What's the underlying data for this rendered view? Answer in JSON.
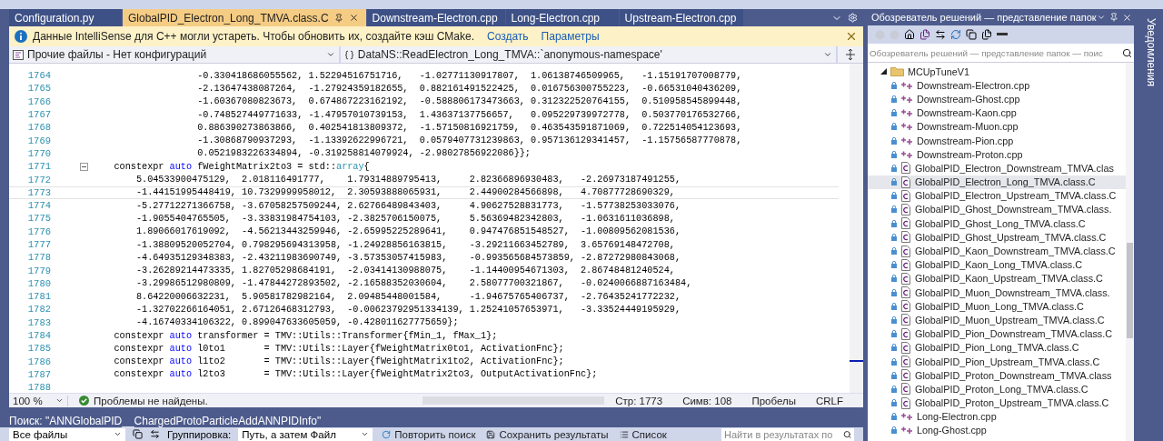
{
  "editor_tabs": [
    {
      "label": "Configuration.py",
      "selected": false
    },
    {
      "label": "GlobalPID_Electron_Long_TMVA.class.C",
      "selected": true
    },
    {
      "label": "Downstream-Electron.cpp",
      "selected": false
    },
    {
      "label": "Long-Electron.cpp",
      "selected": false
    },
    {
      "label": "Upstream-Electron.cpp",
      "selected": false
    }
  ],
  "info_bar": {
    "message": "Данные IntelliSense для C++ могли устареть. Чтобы обновить их, создайте кэш CMake.",
    "links": [
      "Создать",
      "Параметры"
    ]
  },
  "navigation": {
    "project": "Прочие файлы - Нет конфигураций",
    "scope": "DataNS::ReadElectron_Long_TMVA::`anonymous-namespace'"
  },
  "code_lines": [
    {
      "number": "1764",
      "current": false,
      "segments": [
        {
          "kind": "plain",
          "text": "                   -0.330418686055562, 1.52294516751716,   -1.02771130917807,  1.06138746509965,   -1.15191707008779,"
        }
      ]
    },
    {
      "number": "1765",
      "current": false,
      "segments": [
        {
          "kind": "plain",
          "text": "                   -2.13647438087264,  -1.27924359182655,  0.882161491522425,  0.016756300755223,  -0.66531040436209,"
        }
      ]
    },
    {
      "number": "1766",
      "current": false,
      "segments": [
        {
          "kind": "plain",
          "text": "                   -1.60367080823673,  0.674867223162192,  -0.588806173473663, 0.312322520764155,  0.510958545899448,"
        }
      ]
    },
    {
      "number": "1767",
      "current": false,
      "segments": [
        {
          "kind": "plain",
          "text": "                   -0.748527449771633, -1.47957010739153,  1.43637137756657,   0.095229739972778,  0.503770176532766,"
        }
      ]
    },
    {
      "number": "1768",
      "current": false,
      "segments": [
        {
          "kind": "plain",
          "text": "                   0.886390273863866,  0.402541813809372,  -1.57150816921759,  0.463543591871069,  0.722514054123693,"
        }
      ]
    },
    {
      "number": "1769",
      "current": false,
      "segments": [
        {
          "kind": "plain",
          "text": "                   -1.30868790937293,  -1.13392622996721,  0.0579407731239863, 0.957136129341457,  -1.15756587770878,"
        }
      ]
    },
    {
      "number": "1770",
      "current": false,
      "segments": [
        {
          "kind": "plain",
          "text": "                   0.0521983226334894, -0.319258814079924, -2.98027856922086}};"
        }
      ]
    },
    {
      "number": "1771",
      "current": false,
      "expanded": true,
      "segments": [
        {
          "kind": "plain",
          "text": "    constexpr "
        },
        {
          "kind": "keyword",
          "text": "auto"
        },
        {
          "kind": "plain",
          "text": " fWeightMatrix2to3 = std::"
        },
        {
          "kind": "type",
          "text": "array"
        },
        {
          "kind": "plain",
          "text": "{"
        }
      ]
    },
    {
      "number": "1772",
      "current": false,
      "segments": [
        {
          "kind": "plain",
          "text": "        5.04533900475129,  2.018116491777,    1.79314889795413,     2.82366896930483,   -2.26973187491255,"
        }
      ]
    },
    {
      "number": "1773",
      "current": true,
      "segments": [
        {
          "kind": "plain",
          "text": "        -1.44151995448419, 10.7329999958012,  2.30593888065931,     2.44900284566898,   4.70877728690329,"
        }
      ]
    },
    {
      "number": "1774",
      "current": false,
      "segments": [
        {
          "kind": "plain",
          "text": "        -5.27712271366758, -3.67058257509244, 2.62766489843403,     4.90627528831773,   -1.57738253033076,"
        }
      ]
    },
    {
      "number": "1775",
      "current": false,
      "segments": [
        {
          "kind": "plain",
          "text": "        -1.9055404765505,  -3.33831984754103, -2.3825706150075,     5.56369482342803,   -1.0631611036898,"
        }
      ]
    },
    {
      "number": "1776",
      "current": false,
      "segments": [
        {
          "kind": "plain",
          "text": "        1.89066017619092,  -4.56213443259946, -2.65995225289641,    0.947476851548527,  -1.00809562081536,"
        }
      ]
    },
    {
      "number": "1777",
      "current": false,
      "segments": [
        {
          "kind": "plain",
          "text": "        -1.38809520052704, 0.798295694313958, -1.24928856163815,    -3.29211663452789,  3.65769148472708,"
        }
      ]
    },
    {
      "number": "1778",
      "current": false,
      "segments": [
        {
          "kind": "plain",
          "text": "        -4.64935129348383, -2.43211983690749, -3.57353057415983,    -0.993565684573859, -2.87272980843068,"
        }
      ]
    },
    {
      "number": "1779",
      "current": false,
      "segments": [
        {
          "kind": "plain",
          "text": "        -3.26289214473335, 1.82705298684191,  -2.03414130988075,    -1.14400954671303,  2.86748481240524,"
        }
      ]
    },
    {
      "number": "1780",
      "current": false,
      "segments": [
        {
          "kind": "plain",
          "text": "        -3.29986512980809, -1.47844272893502, -2.16588352030604,    2.58077700321867,   -0.0240066887163484,"
        }
      ]
    },
    {
      "number": "1781",
      "current": false,
      "segments": [
        {
          "kind": "plain",
          "text": "        8.64220006632231,  5.90581782982164,  2.09485448001584,     -1.94675765406737,  -2.76435241772232,"
        }
      ]
    },
    {
      "number": "1782",
      "current": false,
      "segments": [
        {
          "kind": "plain",
          "text": "        -1.32702266164051, 2.67126468312793,  -0.00623792951334139, 1.25241057653971,   -3.33524449195929,"
        }
      ]
    },
    {
      "number": "1783",
      "current": false,
      "segments": [
        {
          "kind": "plain",
          "text": "        -4.16740334106322, 0.899047633605059, -0.428011627775659};"
        }
      ]
    },
    {
      "number": "1784",
      "current": false,
      "segments": [
        {
          "kind": "plain",
          "text": "    constexpr "
        },
        {
          "kind": "keyword",
          "text": "auto"
        },
        {
          "kind": "plain",
          "text": " transformer = TMV::Utils::Transformer{fMin_1, fMax_1};"
        }
      ]
    },
    {
      "number": "1785",
      "current": false,
      "segments": [
        {
          "kind": "plain",
          "text": "    constexpr "
        },
        {
          "kind": "keyword",
          "text": "auto"
        },
        {
          "kind": "plain",
          "text": " l0to1       = TMV::Utils::Layer{fWeightMatrix0to1, ActivationFnc};"
        }
      ]
    },
    {
      "number": "1786",
      "current": false,
      "segments": [
        {
          "kind": "plain",
          "text": "    constexpr "
        },
        {
          "kind": "keyword",
          "text": "auto"
        },
        {
          "kind": "plain",
          "text": " l1to2       = TMV::Utils::Layer{fWeightMatrix1to2, ActivationFnc};"
        }
      ]
    },
    {
      "number": "1787",
      "current": false,
      "segments": [
        {
          "kind": "plain",
          "text": "    constexpr "
        },
        {
          "kind": "keyword",
          "text": "auto"
        },
        {
          "kind": "plain",
          "text": " l2to3       = TMV::Utils::Layer{fWeightMatrix2to3, OutputActivationFnc};"
        }
      ]
    },
    {
      "number": "1788",
      "current": false
    }
  ],
  "status_bar": {
    "zoom": "100 %",
    "issues": "Проблемы не найдены.",
    "line": "Стр: 1773",
    "column": "Симв: 108",
    "whitespace": "Пробелы",
    "line_ending": "CRLF"
  },
  "find_panel": {
    "title": "Поиск: \"ANNGlobalPID__ChargedProtoParticleAddANNPIDInfo\"",
    "scope": "Все файлы",
    "grouping_label": "Группировка:",
    "grouping": "Путь, а затем Файл",
    "buttons": [
      "Повторить поиск",
      "Сохранить результаты",
      "Список"
    ],
    "search": {
      "placeholder": "Найти в результатах по"
    }
  },
  "solution_explorer": {
    "title": "Обозреватель решений — представление папок",
    "search": {
      "placeholder": "Обозреватель решений — представление папок — поис"
    },
    "tree": [
      {
        "label": "MCUpTuneV1",
        "kind": "folder",
        "expanded": true,
        "selected": false,
        "children": [
          {
            "label": "Downstream-Electron.cpp",
            "kind": "cpp",
            "selected": false
          },
          {
            "label": "Downstream-Ghost.cpp",
            "kind": "cpp",
            "selected": false
          },
          {
            "label": "Downstream-Kaon.cpp",
            "kind": "cpp",
            "selected": false
          },
          {
            "label": "Downstream-Muon.cpp",
            "kind": "cpp",
            "selected": false
          },
          {
            "label": "Downstream-Pion.cpp",
            "kind": "cpp",
            "selected": false
          },
          {
            "label": "Downstream-Proton.cpp",
            "kind": "cpp",
            "selected": false
          },
          {
            "label": "GlobalPID_Electron_Downstream_TMVA.clas",
            "kind": "c",
            "selected": false
          },
          {
            "label": "GlobalPID_Electron_Long_TMVA.class.C",
            "kind": "c",
            "selected": true
          },
          {
            "label": "GlobalPID_Electron_Upstream_TMVA.class.C",
            "kind": "c",
            "selected": false
          },
          {
            "label": "GlobalPID_Ghost_Downstream_TMVA.class.",
            "kind": "c",
            "selected": false
          },
          {
            "label": "GlobalPID_Ghost_Long_TMVA.class.C",
            "kind": "c",
            "selected": false
          },
          {
            "label": "GlobalPID_Ghost_Upstream_TMVA.class.C",
            "kind": "c",
            "selected": false
          },
          {
            "label": "GlobalPID_Kaon_Downstream_TMVA.class.C",
            "kind": "c",
            "selected": false
          },
          {
            "label": "GlobalPID_Kaon_Long_TMVA.class.C",
            "kind": "c",
            "selected": false
          },
          {
            "label": "GlobalPID_Kaon_Upstream_TMVA.class.C",
            "kind": "c",
            "selected": false
          },
          {
            "label": "GlobalPID_Muon_Downstream_TMVA.class.",
            "kind": "c",
            "selected": false
          },
          {
            "label": "GlobalPID_Muon_Long_TMVA.class.C",
            "kind": "c",
            "selected": false
          },
          {
            "label": "GlobalPID_Muon_Upstream_TMVA.class.C",
            "kind": "c",
            "selected": false
          },
          {
            "label": "GlobalPID_Pion_Downstream_TMVA.class.C",
            "kind": "c",
            "selected": false
          },
          {
            "label": "GlobalPID_Pion_Long_TMVA.class.C",
            "kind": "c",
            "selected": false
          },
          {
            "label": "GlobalPID_Pion_Upstream_TMVA.class.C",
            "kind": "c",
            "selected": false
          },
          {
            "label": "GlobalPID_Proton_Downstream_TMVA.class",
            "kind": "c",
            "selected": false
          },
          {
            "label": "GlobalPID_Proton_Long_TMVA.class.C",
            "kind": "c",
            "selected": false
          },
          {
            "label": "GlobalPID_Proton_Upstream_TMVA.class.C",
            "kind": "c",
            "selected": false
          },
          {
            "label": "Long-Electron.cpp",
            "kind": "cpp",
            "selected": false
          },
          {
            "label": "Long-Ghost.cpp",
            "kind": "cpp",
            "selected": false
          }
        ]
      }
    ]
  },
  "notifications_tab": {
    "label": "Уведомления"
  }
}
